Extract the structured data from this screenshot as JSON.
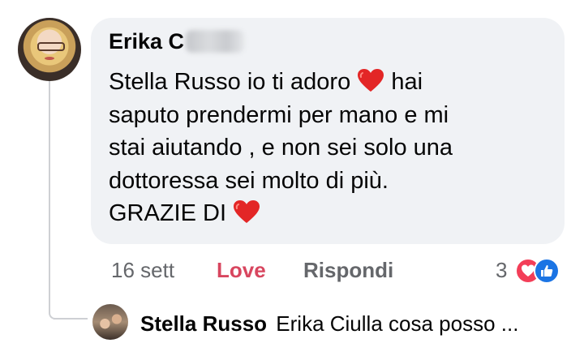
{
  "comment": {
    "author_visible": "Erika C",
    "lines": [
      "Stella Russo io ti adoro",
      "hai",
      "saputo prendermi per mano e mi",
      "stai aiutando , e non sei solo una",
      "dottoressa sei molto di più.",
      "GRAZIE DI"
    ],
    "time": "16 sett",
    "reaction_label": "Love",
    "reply_label": "Rispondi",
    "reaction_count": "3",
    "reaction_icons": [
      "love-icon",
      "like-icon"
    ],
    "colors": {
      "love": "#d8465f",
      "bubble": "#f0f2f5",
      "like": "#1b74e4"
    }
  },
  "reply": {
    "author": "Stella Russo",
    "text": "Erika Ciulla  cosa posso ..."
  }
}
